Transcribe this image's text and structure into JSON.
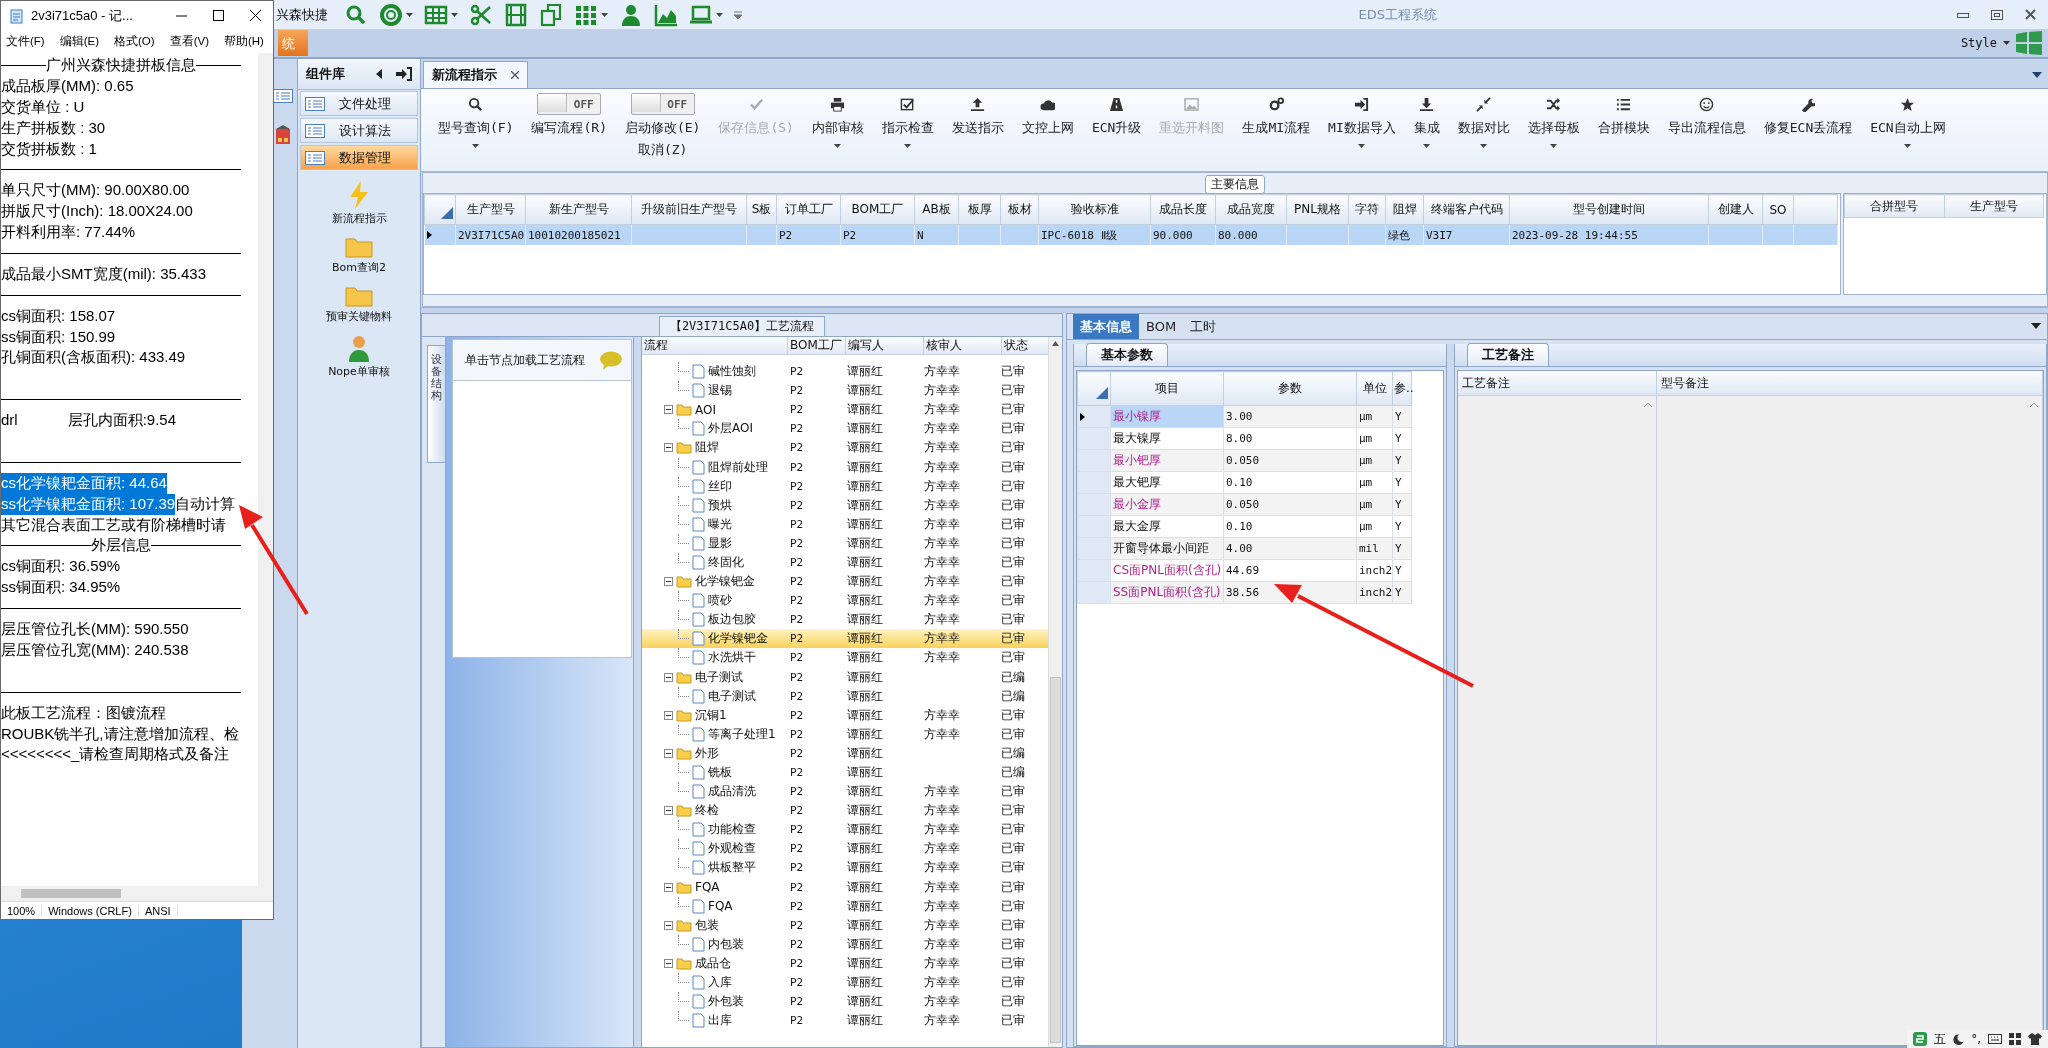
{
  "notepad": {
    "title": "2v3i71c5a0 - 记...",
    "menu": [
      "文件(F)",
      "编辑(E)",
      "格式(O)",
      "查看(V)",
      "帮助(H)"
    ],
    "lines": [
      {
        "kind": "heading",
        "text": "广州兴森快捷拼板信息"
      },
      {
        "kind": "text",
        "text": "成品板厚(MM): 0.65",
        "selected": false
      },
      {
        "kind": "text",
        "text": "交货单位 : U",
        "selected": false
      },
      {
        "kind": "text",
        "text": "生产拼板数 : 30",
        "selected": false
      },
      {
        "kind": "text",
        "text": "交货拼板数 : 1",
        "selected": false
      },
      {
        "kind": "rule"
      },
      {
        "kind": "text",
        "text": "单只尺寸(MM): 90.00X80.00",
        "selected": false
      },
      {
        "kind": "text",
        "text": "拼版尺寸(Inch): 18.00X24.00",
        "selected": false
      },
      {
        "kind": "text",
        "text": "开料利用率: 77.44%",
        "selected": false
      },
      {
        "kind": "rule"
      },
      {
        "kind": "text",
        "text": "成品最小SMT宽度(mil): 35.433",
        "selected": false
      },
      {
        "kind": "rule"
      },
      {
        "kind": "text",
        "text": "cs铜面积: 158.07",
        "selected": false
      },
      {
        "kind": "text",
        "text": "ss铜面积: 150.99",
        "selected": false
      },
      {
        "kind": "text",
        "text": "孔铜面积(含板面积): 433.49",
        "selected": false
      },
      {
        "kind": "blank"
      },
      {
        "kind": "rule"
      },
      {
        "kind": "pair",
        "text": "drl",
        "text2": "层孔内面积:9.54"
      },
      {
        "kind": "blank"
      },
      {
        "kind": "rule"
      },
      {
        "kind": "text",
        "text": "cs化学镍耙金面积: 44.64",
        "selected": true
      },
      {
        "kind": "text",
        "text": "ss化学镍耙金面积: 107.39",
        "selected": true,
        "rest": "自动计算"
      },
      {
        "kind": "text",
        "text": "其它混合表面工艺或有阶梯槽时请",
        "selected": false
      },
      {
        "kind": "heading",
        "text": "外层信息"
      },
      {
        "kind": "text",
        "text": "cs铜面积: 36.59%",
        "selected": false
      },
      {
        "kind": "text",
        "text": "ss铜面积: 34.95%",
        "selected": false
      },
      {
        "kind": "rule"
      },
      {
        "kind": "text",
        "text": "层压管位孔长(MM): 590.550",
        "selected": false
      },
      {
        "kind": "text",
        "text": "层压管位孔宽(MM): 240.538",
        "selected": false
      },
      {
        "kind": "blank"
      },
      {
        "kind": "rule"
      },
      {
        "kind": "text",
        "text": "此板工艺流程：图镀流程",
        "selected": false
      },
      {
        "kind": "text",
        "text": "ROUBK铣半孔,请注意增加流程、检",
        "selected": false
      },
      {
        "kind": "text",
        "text": "<<<<<<<<_请检查周期格式及备注",
        "selected": false
      }
    ],
    "status_bar": [
      "100%",
      "Windows (CRLF)",
      "ANSI"
    ]
  },
  "app": {
    "quick_access_label": "兴森快捷",
    "title": "EDS工程系统",
    "ribbon_tab": "统",
    "style_label": "Style",
    "side_panel": {
      "title": "组件库",
      "categories": [
        {
          "label": "文件处理",
          "selected": false
        },
        {
          "label": "设计算法",
          "selected": false
        },
        {
          "label": "数据管理",
          "selected": true
        }
      ],
      "modules": [
        "新流程指示",
        "Bom查询2",
        "预审关键物料",
        "Nope单审核"
      ]
    },
    "doc_tab": "新流程指示",
    "ribbon": [
      {
        "kind": "button",
        "label": "型号查询(F)",
        "dropdown": true,
        "disabled": false
      },
      {
        "kind": "toggle",
        "label": "编写流程(R)",
        "switch_text": "OFF",
        "on": false
      },
      {
        "kind": "toggle",
        "label": "启动修改(E)",
        "label2": "取消(Z)",
        "switch_text": "OFF",
        "on": false
      },
      {
        "kind": "button",
        "label": "保存信息(S)",
        "dropdown": false,
        "disabled": true
      },
      {
        "kind": "button",
        "label": "内部审核",
        "dropdown": true,
        "disabled": false
      },
      {
        "kind": "button",
        "label": "指示检查",
        "dropdown": true,
        "disabled": false
      },
      {
        "kind": "button",
        "label": "发送指示",
        "dropdown": false,
        "disabled": false
      },
      {
        "kind": "button",
        "label": "文控上网",
        "dropdown": false,
        "disabled": false
      },
      {
        "kind": "button",
        "label": "ECN升级",
        "dropdown": false,
        "disabled": false
      },
      {
        "kind": "button",
        "label": "重选开料图",
        "dropdown": false,
        "disabled": true
      },
      {
        "kind": "button",
        "label": "生成MI流程",
        "dropdown": false,
        "disabled": false
      },
      {
        "kind": "button",
        "label": "MI数据导入",
        "dropdown": true,
        "disabled": false
      },
      {
        "kind": "button",
        "label": "集成",
        "dropdown": true,
        "disabled": false
      },
      {
        "kind": "button",
        "label": "数据对比",
        "dropdown": true,
        "disabled": false
      },
      {
        "kind": "button",
        "label": "选择母板",
        "dropdown": true,
        "disabled": false
      },
      {
        "kind": "button",
        "label": "合拼模块",
        "dropdown": false,
        "disabled": false
      },
      {
        "kind": "button",
        "label": "导出流程信息",
        "dropdown": false,
        "disabled": false
      },
      {
        "kind": "button",
        "label": "修复ECN丢流程",
        "dropdown": false,
        "disabled": false
      },
      {
        "kind": "button",
        "label": "ECN自动上网",
        "dropdown": true,
        "disabled": false
      }
    ],
    "main_info": {
      "title": "主要信息",
      "columns": [
        "生产型号",
        "新生产型号",
        "升级前旧生产型号",
        "S板",
        "订单工厂",
        "BOM工厂",
        "AB板",
        "板厚",
        "板材",
        "验收标准",
        "成品长度",
        "成品宽度",
        "PNL规格",
        "字符",
        "阻焊",
        "终端客户代码",
        "型号创建时间",
        "创建人",
        "SO"
      ],
      "rows": [
        {
          "selected": true,
          "cells": [
            "2V3I71C5A0",
            "10010200185021",
            null,
            null,
            "P2",
            "P2",
            "N",
            null,
            null,
            "IPC-6018 Ⅱ级",
            "90.000",
            "80.000",
            null,
            null,
            "绿色",
            "V3I7",
            "2023-09-28 19:44:55",
            null,
            null
          ]
        }
      ],
      "side_columns": [
        "合拼型号",
        "生产型号"
      ]
    },
    "process": {
      "title": "【2V3I71C5A0】工艺流程",
      "side_tab": "设备结构",
      "hint": "单击节点加载工艺流程",
      "columns": [
        "流程",
        "BOM工厂",
        "编写人",
        "核审人",
        "状态"
      ],
      "continued": [
        {
          "name": "碱性蚀刻",
          "factory": "P2",
          "writer": "谭丽红",
          "reviewer": "方幸幸",
          "status": "已审",
          "selected": false
        },
        {
          "name": "退锡",
          "factory": "P2",
          "writer": "谭丽红",
          "reviewer": "方幸幸",
          "status": "已审",
          "selected": false
        }
      ],
      "items": [
        {
          "name": "AOI",
          "factory": "P2",
          "writer": "谭丽红",
          "reviewer": "方幸幸",
          "status": "已审",
          "selected": false,
          "expanded": true,
          "children": [
            {
              "name": "外层AOI",
              "factory": "P2",
              "writer": "谭丽红",
              "reviewer": "方幸幸",
              "status": "已审",
              "selected": false
            }
          ]
        },
        {
          "name": "阻焊",
          "factory": "P2",
          "writer": "谭丽红",
          "reviewer": "方幸幸",
          "status": "已审",
          "selected": false,
          "expanded": true,
          "children": [
            {
              "name": "阻焊前处理",
              "factory": "P2",
              "writer": "谭丽红",
              "reviewer": "方幸幸",
              "status": "已审",
              "selected": false
            },
            {
              "name": "丝印",
              "factory": "P2",
              "writer": "谭丽红",
              "reviewer": "方幸幸",
              "status": "已审",
              "selected": false
            },
            {
              "name": "预烘",
              "factory": "P2",
              "writer": "谭丽红",
              "reviewer": "方幸幸",
              "status": "已审",
              "selected": false
            },
            {
              "name": "曝光",
              "factory": "P2",
              "writer": "谭丽红",
              "reviewer": "方幸幸",
              "status": "已审",
              "selected": false
            },
            {
              "name": "显影",
              "factory": "P2",
              "writer": "谭丽红",
              "reviewer": "方幸幸",
              "status": "已审",
              "selected": false
            },
            {
              "name": "终固化",
              "factory": "P2",
              "writer": "谭丽红",
              "reviewer": "方幸幸",
              "status": "已审",
              "selected": false
            }
          ]
        },
        {
          "name": "化学镍钯金",
          "factory": "P2",
          "writer": "谭丽红",
          "reviewer": "方幸幸",
          "status": "已审",
          "selected": false,
          "expanded": true,
          "children": [
            {
              "name": "喷砂",
              "factory": "P2",
              "writer": "谭丽红",
              "reviewer": "方幸幸",
              "status": "已审",
              "selected": false
            },
            {
              "name": "板边包胶",
              "factory": "P2",
              "writer": "谭丽红",
              "reviewer": "方幸幸",
              "status": "已审",
              "selected": false
            },
            {
              "name": "化学镍钯金",
              "factory": "P2",
              "writer": "谭丽红",
              "reviewer": "方幸幸",
              "status": "已审",
              "selected": true
            },
            {
              "name": "水洗烘干",
              "factory": "P2",
              "writer": "谭丽红",
              "reviewer": "方幸幸",
              "status": "已审",
              "selected": false
            }
          ]
        },
        {
          "name": "电子测试",
          "factory": "P2",
          "writer": "谭丽红",
          "status": "已编",
          "selected": false,
          "expanded": true,
          "children": [
            {
              "name": "电子测试",
              "factory": "P2",
              "writer": "谭丽红",
              "status": "已编",
              "selected": false
            }
          ]
        },
        {
          "name": "沉铜1",
          "factory": "P2",
          "writer": "谭丽红",
          "reviewer": "方幸幸",
          "status": "已审",
          "selected": false,
          "expanded": true,
          "children": [
            {
              "name": "等离子处理1",
              "factory": "P2",
              "writer": "谭丽红",
              "reviewer": "方幸幸",
              "status": "已审",
              "selected": false
            }
          ]
        },
        {
          "name": "外形",
          "factory": "P2",
          "writer": "谭丽红",
          "status": "已编",
          "selected": false,
          "expanded": true,
          "children": [
            {
              "name": "铣板",
              "factory": "P2",
              "writer": "谭丽红",
              "status": "已编",
              "selected": false
            },
            {
              "name": "成品清洗",
              "factory": "P2",
              "writer": "谭丽红",
              "reviewer": "方幸幸",
              "status": "已审",
              "selected": false
            }
          ]
        },
        {
          "name": "终检",
          "factory": "P2",
          "writer": "谭丽红",
          "reviewer": "方幸幸",
          "status": "已审",
          "selected": false,
          "expanded": true,
          "children": [
            {
              "name": "功能检查",
              "factory": "P2",
              "writer": "谭丽红",
              "reviewer": "方幸幸",
              "status": "已审",
              "selected": false
            },
            {
              "name": "外观检查",
              "factory": "P2",
              "writer": "谭丽红",
              "reviewer": "方幸幸",
              "status": "已审",
              "selected": false
            },
            {
              "name": "烘板整平",
              "factory": "P2",
              "writer": "谭丽红",
              "reviewer": "方幸幸",
              "status": "已审",
              "selected": false
            }
          ]
        },
        {
          "name": "FQA",
          "factory": "P2",
          "writer": "谭丽红",
          "reviewer": "方幸幸",
          "status": "已审",
          "selected": false,
          "expanded": true,
          "children": [
            {
              "name": "FQA",
              "factory": "P2",
              "writer": "谭丽红",
              "reviewer": "方幸幸",
              "status": "已审",
              "selected": false
            }
          ]
        },
        {
          "name": "包装",
          "factory": "P2",
          "writer": "谭丽红",
          "reviewer": "方幸幸",
          "status": "已审",
          "selected": false,
          "expanded": true,
          "children": [
            {
              "name": "内包装",
              "factory": "P2",
              "writer": "谭丽红",
              "reviewer": "方幸幸",
              "status": "已审",
              "selected": false
            }
          ]
        },
        {
          "name": "成品仓",
          "factory": "P2",
          "writer": "谭丽红",
          "reviewer": "方幸幸",
          "status": "已审",
          "selected": false,
          "expanded": true,
          "children": [
            {
              "name": "入库",
              "factory": "P2",
              "writer": "谭丽红",
              "reviewer": "方幸幸",
              "status": "已审",
              "selected": false
            },
            {
              "name": "外包装",
              "factory": "P2",
              "writer": "谭丽红",
              "reviewer": "方幸幸",
              "status": "已审",
              "selected": false
            },
            {
              "name": "出库",
              "factory": "P2",
              "writer": "谭丽红",
              "reviewer": "方幸幸",
              "status": "已审",
              "selected": false
            }
          ]
        }
      ]
    },
    "detail": {
      "tabs": [
        {
          "label": "基本信息",
          "selected": true
        },
        {
          "label": "BOM",
          "selected": false
        },
        {
          "label": "工时",
          "selected": false
        }
      ],
      "params": {
        "tab": "基本参数",
        "columns": [
          "项目",
          "参数",
          "单位",
          "参.."
        ],
        "rows": [
          {
            "item": "最小镍厚",
            "value": "3.00",
            "unit": "μm",
            "flag": "Y",
            "highlighted": true,
            "selected": true
          },
          {
            "item": "最大镍厚",
            "value": "8.00",
            "unit": "μm",
            "flag": "Y",
            "highlighted": false,
            "selected": false
          },
          {
            "item": "最小钯厚",
            "value": "0.050",
            "unit": "μm",
            "flag": "Y",
            "highlighted": true,
            "selected": false
          },
          {
            "item": "最大钯厚",
            "value": "0.10",
            "unit": "μm",
            "flag": "Y",
            "highlighted": false,
            "selected": false
          },
          {
            "item": "最小金厚",
            "value": "0.050",
            "unit": "μm",
            "flag": "Y",
            "highlighted": true,
            "selected": false
          },
          {
            "item": "最大金厚",
            "value": "0.10",
            "unit": "μm",
            "flag": "Y",
            "highlighted": false,
            "selected": false
          },
          {
            "item": "开窗导体最小间距",
            "value": "4.00",
            "unit": "mil",
            "flag": "Y",
            "highlighted": false,
            "selected": false
          },
          {
            "item": "CS面PNL面积(含孔)",
            "value": "44.69",
            "unit": "inch2",
            "flag": "Y",
            "highlighted": true,
            "selected": false
          },
          {
            "item": "SS面PNL面积(含孔)",
            "value": "38.56",
            "unit": "inch2",
            "flag": "Y",
            "highlighted": true,
            "selected": false
          }
        ]
      },
      "notes": {
        "tab": "工艺备注",
        "columns": [
          "工艺备注",
          "型号备注"
        ]
      }
    },
    "tray": {
      "ime": "五",
      "punctuation": "°,"
    }
  }
}
